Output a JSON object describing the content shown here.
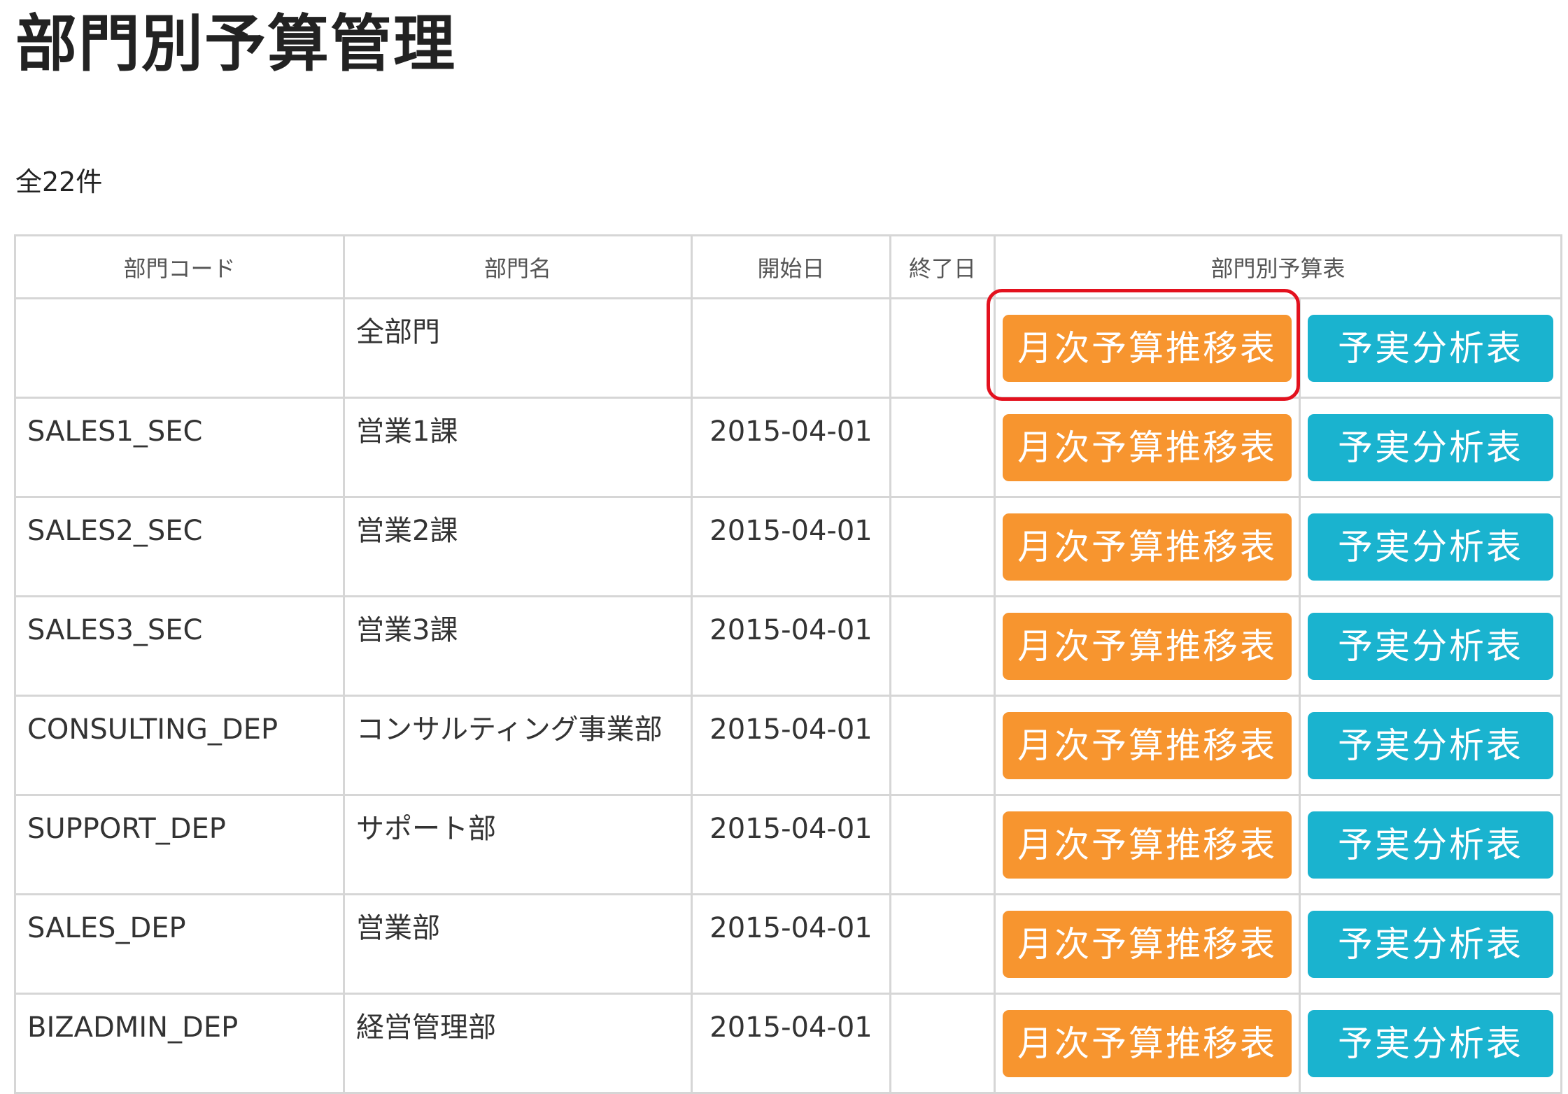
{
  "page_title": "部門別予算管理",
  "total_count": "全22件",
  "table": {
    "headers": {
      "code": "部門コード",
      "name": "部門名",
      "start": "開始日",
      "end": "終了日",
      "budget": "部門別予算表"
    },
    "rows": [
      {
        "code": "",
        "name": "全部門",
        "start": "",
        "end": ""
      },
      {
        "code": "SALES1_SEC",
        "name": "営業1課",
        "start": "2015-04-01",
        "end": ""
      },
      {
        "code": "SALES2_SEC",
        "name": "営業2課",
        "start": "2015-04-01",
        "end": ""
      },
      {
        "code": "SALES3_SEC",
        "name": "営業3課",
        "start": "2015-04-01",
        "end": ""
      },
      {
        "code": "CONSULTING_DEP",
        "name": "コンサルティング事業部",
        "start": "2015-04-01",
        "end": ""
      },
      {
        "code": "SUPPORT_DEP",
        "name": "サポート部",
        "start": "2015-04-01",
        "end": ""
      },
      {
        "code": "SALES_DEP",
        "name": "営業部",
        "start": "2015-04-01",
        "end": ""
      },
      {
        "code": "BIZADMIN_DEP",
        "name": "経営管理部",
        "start": "2015-04-01",
        "end": ""
      }
    ]
  },
  "buttons": {
    "monthly_label": "月次予算推移表",
    "analysis_label": "予実分析表"
  },
  "colors": {
    "monthly_button": "#f7952f",
    "analysis_button": "#1ab3cf",
    "highlight": "#e3111e",
    "border": "#d6d6d6"
  }
}
